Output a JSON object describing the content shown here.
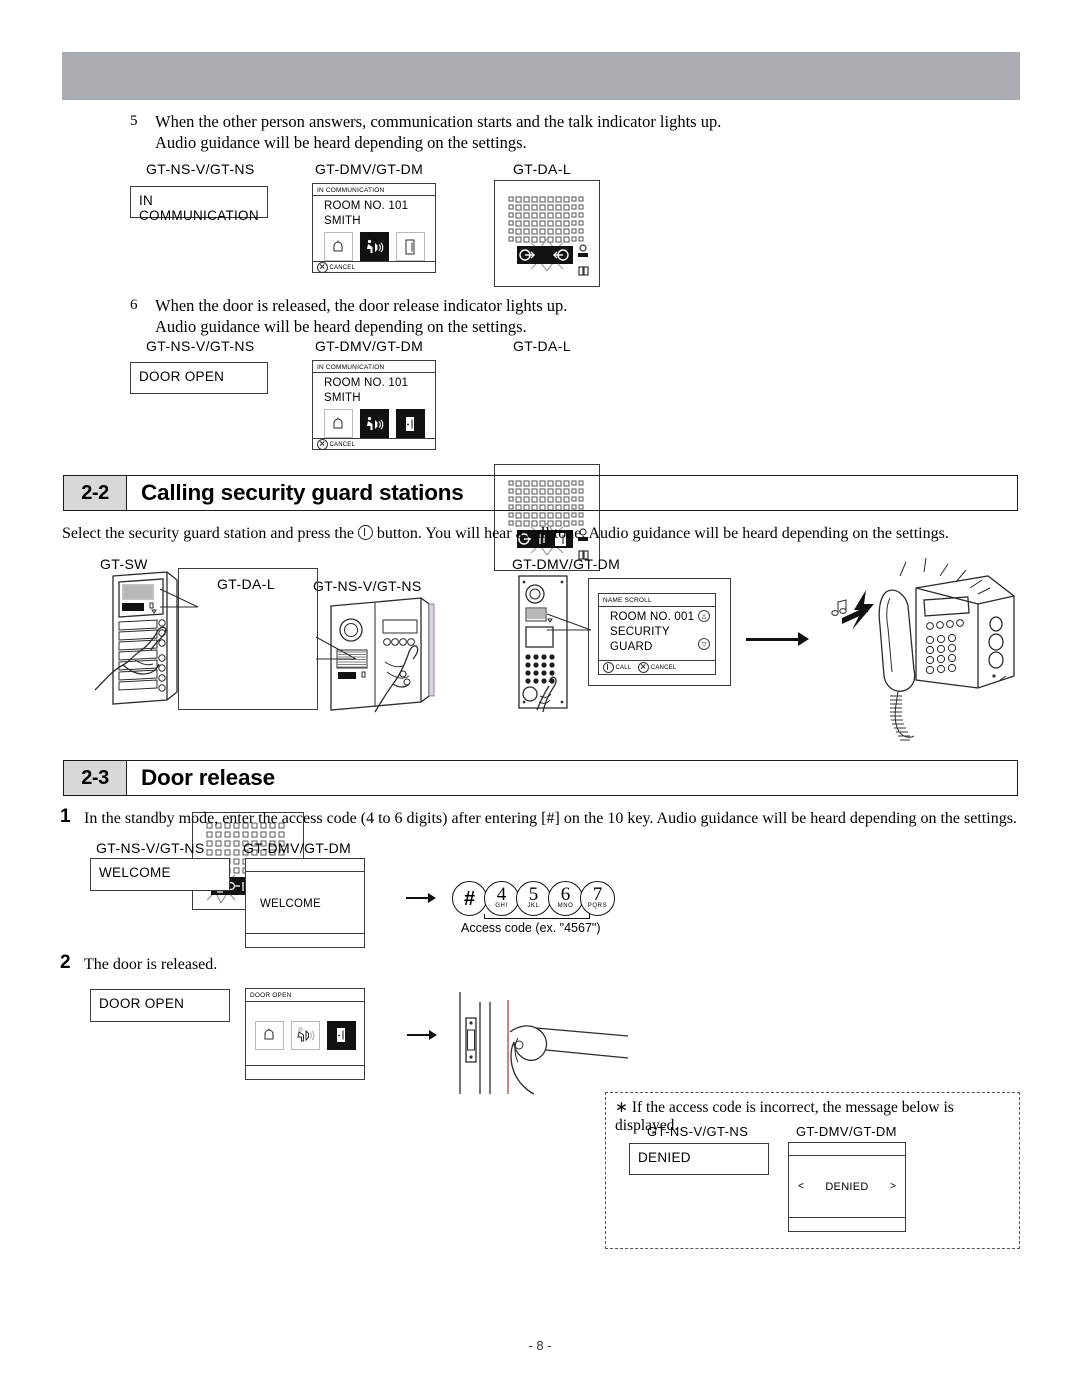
{
  "page": {
    "number": "- 8 -"
  },
  "steps": {
    "step5": {
      "num": "5",
      "line1": "When the other person answers, communication starts and the talk indicator lights up.",
      "line2": "Audio guidance will be heard depending on the settings.",
      "captions": {
        "ns": "GT-NS-V/GT-NS",
        "dmv": "GT-DMV/GT-DM",
        "dal": "GT-DA-L"
      },
      "ns_display": "IN COMMUNICATION",
      "dmv_display": {
        "title": "IN COMMUNICATION",
        "line1": "ROOM NO. 101",
        "line2": "SMITH",
        "footer": "CANCEL"
      }
    },
    "step6": {
      "num": "6",
      "line1": "When the door is released, the door release indicator lights up.",
      "line2": "Audio guidance will be heard depending on the settings.",
      "captions": {
        "ns": "GT-NS-V/GT-NS",
        "dmv": "GT-DMV/GT-DM",
        "dal": "GT-DA-L"
      },
      "ns_display": "DOOR OPEN",
      "dmv_display": {
        "title": "IN COMMUNICATION",
        "line1": "ROOM NO. 101",
        "line2": "SMITH",
        "footer": "CANCEL"
      }
    }
  },
  "section_2_2": {
    "number": "2-2",
    "title": "Calling security guard stations",
    "lead_before": "Select the security guard station and press the ",
    "lead_after": " button. You will hear a call tone. Audio guidance will be heard depending on the settings.",
    "captions": {
      "sw": "GT-SW",
      "dal": "GT-DA-L",
      "ns": "GT-NS-V/GT-NS",
      "dmv": "GT-DMV/GT-DM"
    },
    "guard_display": {
      "title": "NAME SCROLL",
      "line1": "ROOM NO. 001",
      "line2": "SECURITY GUARD",
      "footer_call": "CALL",
      "footer_cancel": "CANCEL"
    }
  },
  "section_2_3": {
    "number": "2-3",
    "title": "Door release",
    "step1": {
      "num": "1",
      "text": "In the standby mode, enter the access code (4 to 6 digits) after entering [#] on the 10 key. Audio guidance will be heard depending on the settings.",
      "captions": {
        "ns": "GT-NS-V/GT-NS",
        "dmv": "GT-DMV/GT-DM"
      },
      "ns_display": "WELCOME",
      "dmv_display": "WELCOME",
      "keys": [
        {
          "digit": "#",
          "letters": ""
        },
        {
          "digit": "4",
          "letters": "GHI"
        },
        {
          "digit": "5",
          "letters": "JKL"
        },
        {
          "digit": "6",
          "letters": "MNO"
        },
        {
          "digit": "7",
          "letters": "PQRS"
        }
      ],
      "key_caption": "Access code (ex. \"4567\")"
    },
    "step2": {
      "num": "2",
      "text": "The door is released.",
      "ns_display": "DOOR OPEN",
      "dmv_display": {
        "title": "DOOR OPEN"
      }
    },
    "note": {
      "text": "∗ If the access code is incorrect, the message below is displayed.",
      "captions": {
        "ns": "GT-NS-V/GT-NS",
        "dmv": "GT-DMV/GT-DM"
      },
      "ns_display": "DENIED",
      "dmv_display": {
        "left_arrow": "<",
        "text": "DENIED",
        "right_arrow": ">"
      }
    }
  },
  "colors": {
    "banner": "#a9adb2",
    "section_number_bg": "#d8d8d8",
    "ink": "#1a1a1a"
  }
}
